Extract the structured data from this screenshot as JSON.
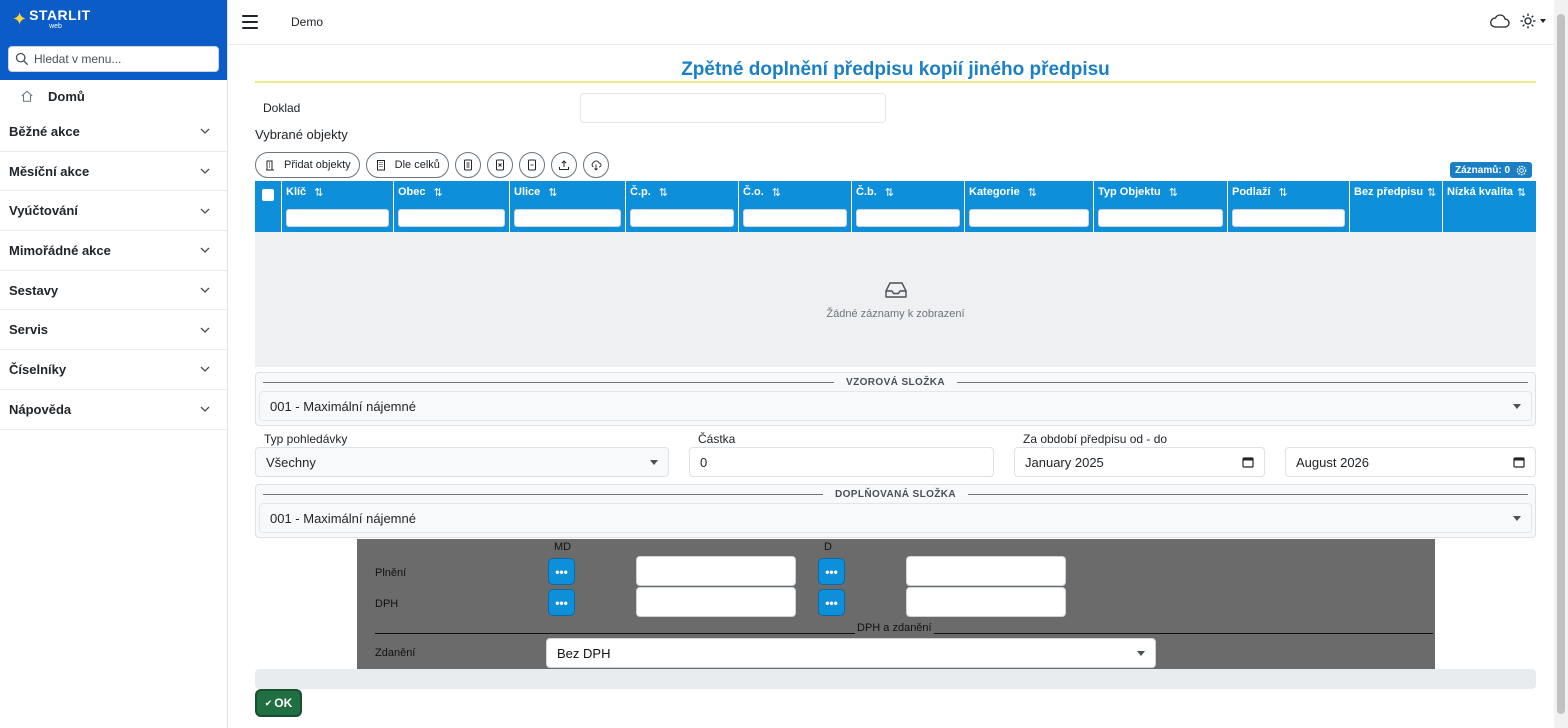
{
  "brand": {
    "name": "STARLIT",
    "sub": "web"
  },
  "sidebar": {
    "search_placeholder": "Hledat v menu...",
    "home_label": "Domů",
    "items": [
      {
        "label": "Běžné akce"
      },
      {
        "label": "Měsíční akce"
      },
      {
        "label": "Vyúčtování"
      },
      {
        "label": "Mimořádné akce"
      },
      {
        "label": "Sestavy"
      },
      {
        "label": "Servis"
      },
      {
        "label": "Číselníky"
      },
      {
        "label": "Nápověda"
      }
    ]
  },
  "topbar": {
    "crumb": "Demo",
    "icons": [
      "cloud-icon",
      "sun-icon",
      "caret-down-icon"
    ]
  },
  "page": {
    "title": "Zpětné doplnění předpisu kopií jiného předpisu",
    "doklad_label": "Doklad",
    "doklad_value": "",
    "selected_objects_label": "Vybrané objekty"
  },
  "toolbar": {
    "add_objects": "Přidat objekty",
    "by_units": "Dle celků",
    "records_label": "Záznamů:",
    "records_count": "0"
  },
  "grid": {
    "columns": [
      "Klíč",
      "Obec",
      "Ulice",
      "Č.p.",
      "Č.o.",
      "Č.b.",
      "Kategorie",
      "Typ Objektu",
      "Podlaží",
      "Bez předpisu",
      "Nízká kvalita"
    ],
    "sort_glyph": "⇅",
    "empty_text": "Žádné záznamy k zobrazení"
  },
  "vzorova": {
    "legend": "VZOROVÁ SLOŽKA",
    "value": "001 - Maximální nájemné"
  },
  "fields": {
    "typ_label": "Typ pohledávky",
    "typ_value": "Všechny",
    "castka_label": "Částka",
    "castka_value": "0",
    "obdobi_label": "Za období předpisu od - do",
    "od_value": "January 2025",
    "do_value": "August 2026"
  },
  "doplnovana": {
    "legend": "DOPLŇOVANÁ SLOŽKA",
    "value": "001 - Maximální nájemné"
  },
  "accounts": {
    "md_label": "MD",
    "d_label": "D",
    "plneni_label": "Plnění",
    "dph_label": "DPH",
    "dots_label": "•••",
    "section_label": "DPH a zdanění",
    "zdaneni_label": "Zdanění",
    "zdaneni_value": "Bez DPH"
  },
  "actions": {
    "ok_label": "OK",
    "ok_check": "✔"
  },
  "colors": {
    "brand": "#0b5cc7",
    "grid_header": "#0d8fd9",
    "title": "#1a7fc4",
    "ok": "#1f6f42",
    "dark_panel": "#6b6b6b"
  }
}
